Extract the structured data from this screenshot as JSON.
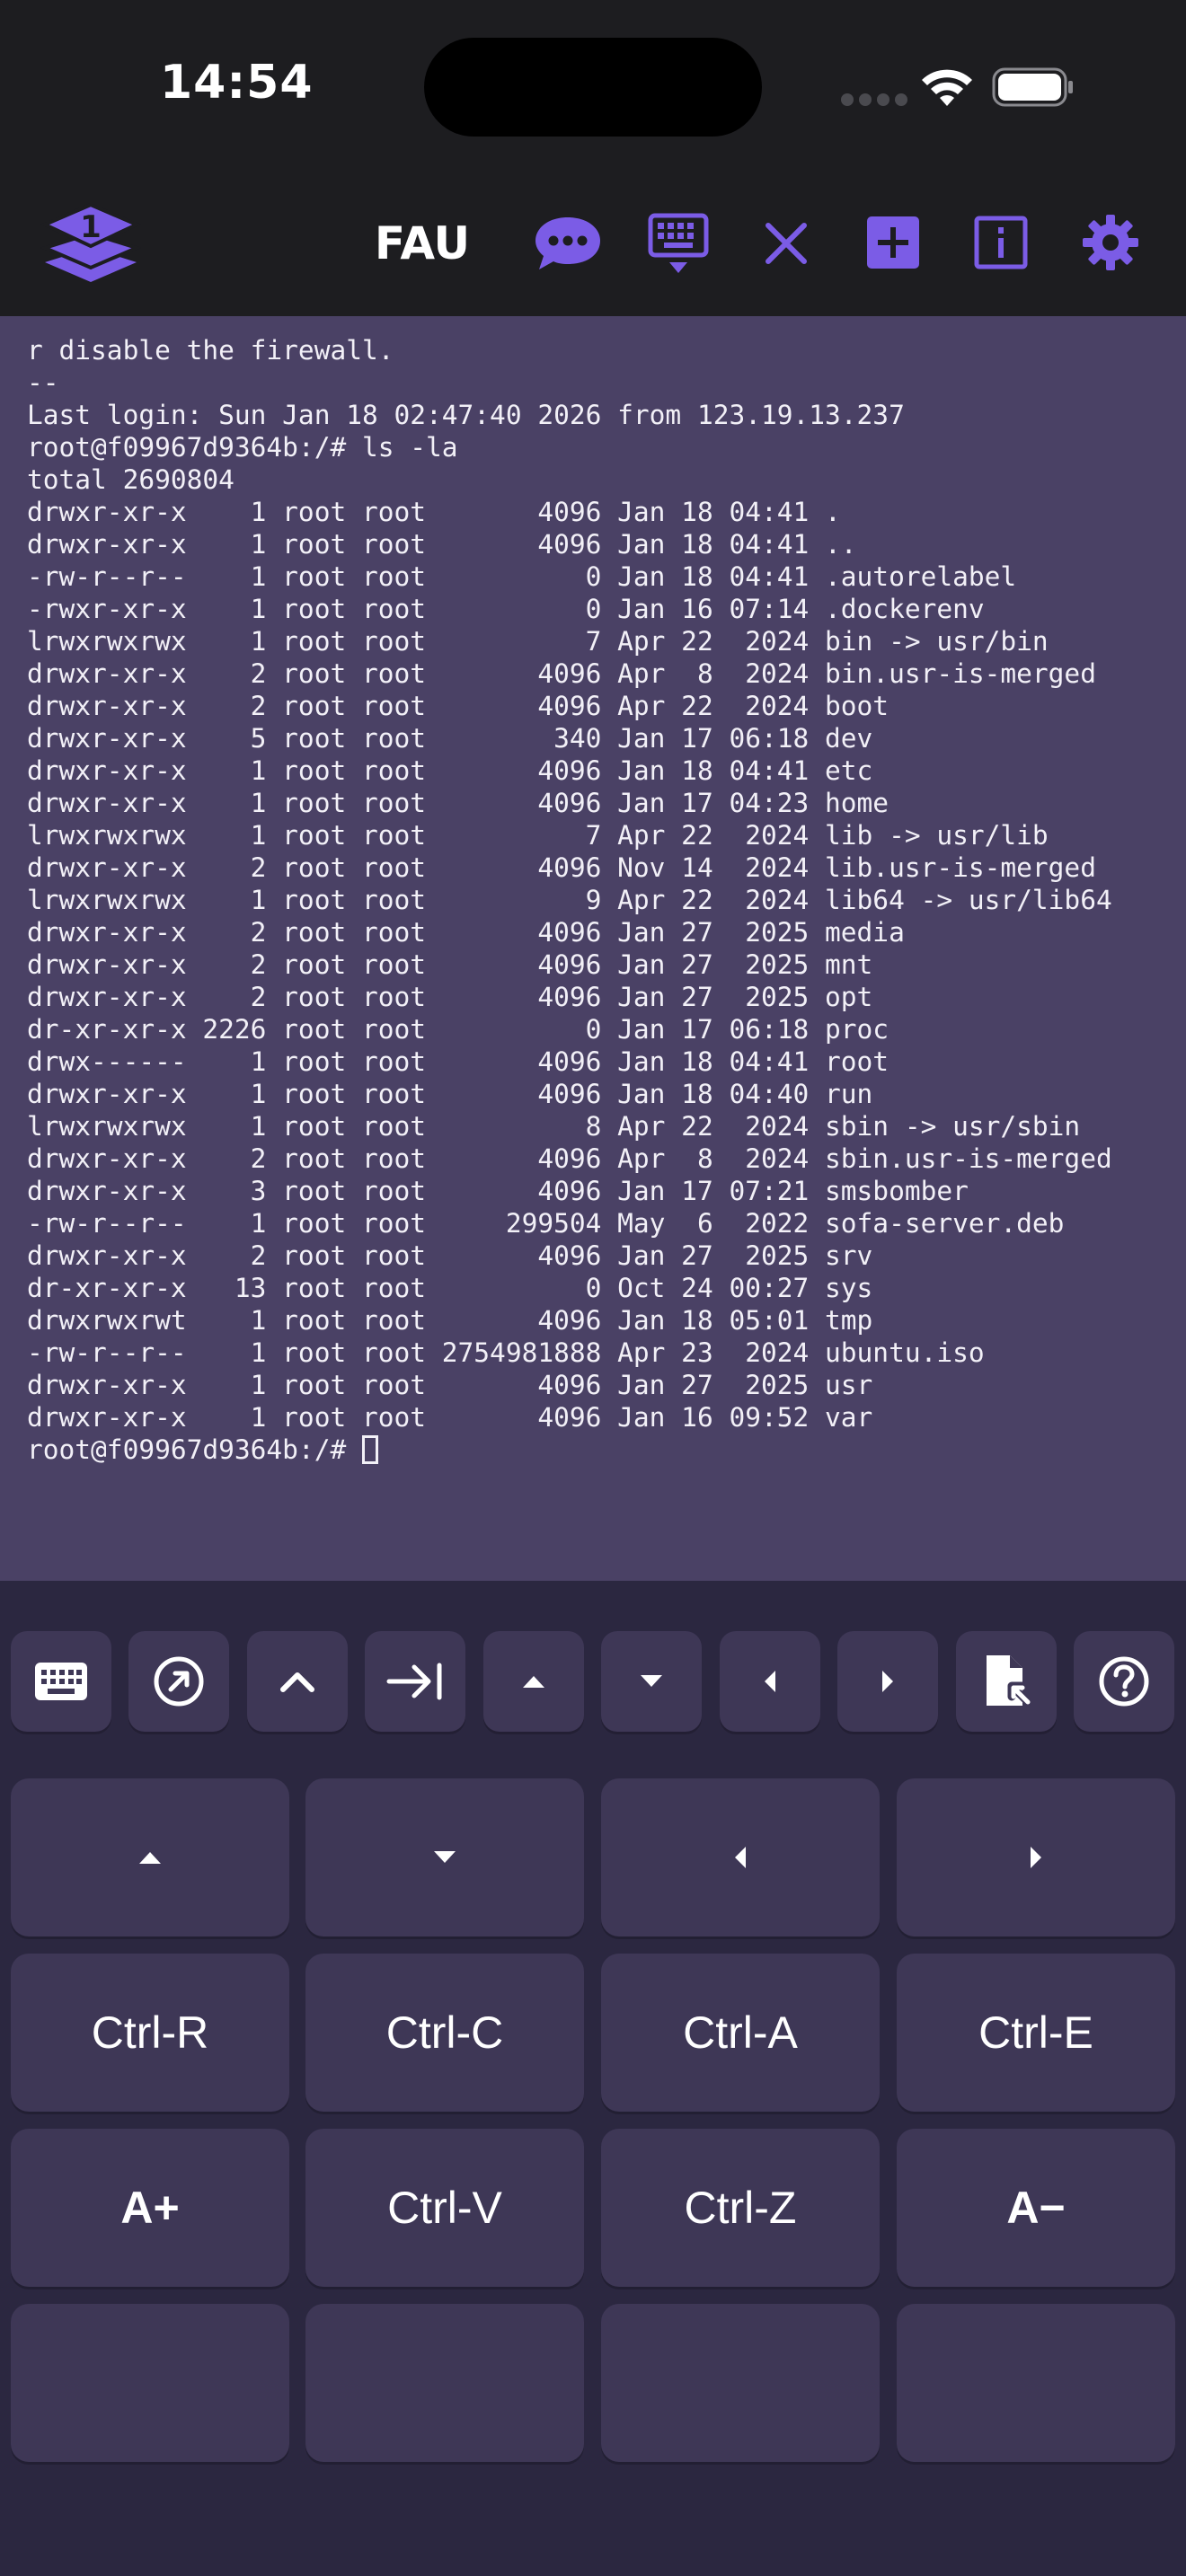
{
  "status_bar": {
    "time": "14:54"
  },
  "toolbar": {
    "session_badge": "1",
    "title": "FAU",
    "icons": [
      "layers-icon",
      "chat-icon",
      "keyboard-icon",
      "close-icon",
      "add-icon",
      "info-icon",
      "gear-icon"
    ]
  },
  "colors": {
    "accent": "#7b5ce6",
    "terminal_bg": "#4a4165",
    "keyboard_bg": "#2b2740",
    "key_bg": "#3e3756",
    "toolbar_bg": "#1d1d20"
  },
  "terminal": {
    "lines": [
      "r disable the firewall.",
      "--",
      "Last login: Sun Jan 18 02:47:40 2026 from 123.19.13.237",
      "root@f09967d9364b:/# ls -la",
      "total 2690804",
      "drwxr-xr-x    1 root root       4096 Jan 18 04:41 .",
      "drwxr-xr-x    1 root root       4096 Jan 18 04:41 ..",
      "-rw-r--r--    1 root root          0 Jan 18 04:41 .autorelabel",
      "-rwxr-xr-x    1 root root          0 Jan 16 07:14 .dockerenv",
      "lrwxrwxrwx    1 root root          7 Apr 22  2024 bin -> usr/bin",
      "drwxr-xr-x    2 root root       4096 Apr  8  2024 bin.usr-is-merged",
      "drwxr-xr-x    2 root root       4096 Apr 22  2024 boot",
      "drwxr-xr-x    5 root root        340 Jan 17 06:18 dev",
      "drwxr-xr-x    1 root root       4096 Jan 18 04:41 etc",
      "drwxr-xr-x    1 root root       4096 Jan 17 04:23 home",
      "lrwxrwxrwx    1 root root          7 Apr 22  2024 lib -> usr/lib",
      "drwxr-xr-x    2 root root       4096 Nov 14  2024 lib.usr-is-merged",
      "lrwxrwxrwx    1 root root          9 Apr 22  2024 lib64 -> usr/lib64",
      "drwxr-xr-x    2 root root       4096 Jan 27  2025 media",
      "drwxr-xr-x    2 root root       4096 Jan 27  2025 mnt",
      "drwxr-xr-x    2 root root       4096 Jan 27  2025 opt",
      "dr-xr-xr-x 2226 root root          0 Jan 17 06:18 proc",
      "drwx------    1 root root       4096 Jan 18 04:41 root",
      "drwxr-xr-x    1 root root       4096 Jan 18 04:40 run",
      "lrwxrwxrwx    1 root root          8 Apr 22  2024 sbin -> usr/sbin",
      "drwxr-xr-x    2 root root       4096 Apr  8  2024 sbin.usr-is-merged",
      "drwxr-xr-x    3 root root       4096 Jan 17 07:21 smsbomber",
      "-rw-r--r--    1 root root     299504 May  6  2022 sofa-server.deb",
      "drwxr-xr-x    2 root root       4096 Jan 27  2025 srv",
      "dr-xr-xr-x   13 root root          0 Oct 24 00:27 sys",
      "drwxrwxrwt    1 root root       4096 Jan 18 05:01 tmp",
      "-rw-r--r--    1 root root 2754981888 Apr 23  2024 ubuntu.iso",
      "drwxr-xr-x    1 root root       4096 Jan 27  2025 usr",
      "drwxr-xr-x    1 root root       4096 Jan 16 09:52 var"
    ],
    "prompt": "root@f09967d9364b:/# "
  },
  "function_row": {
    "keys": [
      {
        "name": "keyboard-icon"
      },
      {
        "name": "arrow-up-right-circle-icon"
      },
      {
        "name": "caret-up-icon"
      },
      {
        "name": "tab-icon"
      },
      {
        "name": "triangle-up-icon"
      },
      {
        "name": "triangle-down-icon"
      },
      {
        "name": "triangle-left-icon"
      },
      {
        "name": "triangle-right-icon"
      },
      {
        "name": "file-export-icon"
      },
      {
        "name": "help-icon"
      }
    ]
  },
  "extra_keys": {
    "row2": [
      "Ctrl-R",
      "Ctrl-C",
      "Ctrl-A",
      "Ctrl-E"
    ],
    "row3": [
      "A+",
      "Ctrl-V",
      "Ctrl-Z",
      "A−"
    ],
    "row4": [
      "",
      "",
      "",
      ""
    ]
  }
}
